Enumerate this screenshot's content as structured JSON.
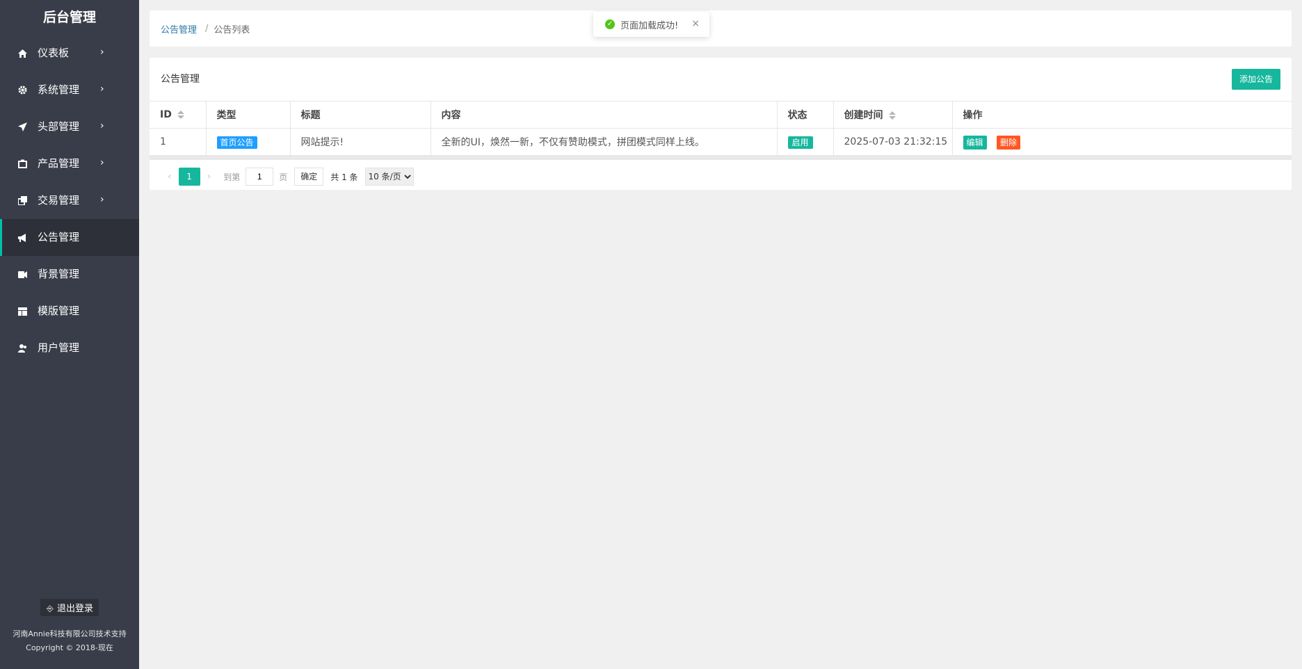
{
  "sidebar": {
    "brand": "后台管理",
    "items": [
      {
        "label": "仪表板",
        "icon": "home-icon",
        "has_arrow": true
      },
      {
        "label": "系统管理",
        "icon": "gear-icon",
        "has_arrow": true
      },
      {
        "label": "头部管理",
        "icon": "send-icon",
        "has_arrow": true
      },
      {
        "label": "产品管理",
        "icon": "box-icon",
        "has_arrow": true
      },
      {
        "label": "交易管理",
        "icon": "copy-icon",
        "has_arrow": true
      },
      {
        "label": "公告管理",
        "icon": "megaphone-icon",
        "has_arrow": false,
        "active": true
      },
      {
        "label": "背景管理",
        "icon": "video-icon",
        "has_arrow": false
      },
      {
        "label": "模版管理",
        "icon": "layout-icon",
        "has_arrow": false
      },
      {
        "label": "用户管理",
        "icon": "users-icon",
        "has_arrow": false
      }
    ],
    "arrow_glyph": "›",
    "logout_label": "退出登录",
    "support_text": "河南Annie科技有限公司技术支持",
    "copyright_text": "Copyright © 2018-现在"
  },
  "breadcrumb": {
    "parent": "公告管理",
    "separator": "/",
    "current": "公告列表"
  },
  "toast": {
    "message": "页面加载成功!",
    "close_glyph": "×"
  },
  "card": {
    "title": "公告管理",
    "add_label": "添加公告"
  },
  "table": {
    "columns": [
      "ID",
      "类型",
      "标题",
      "内容",
      "状态",
      "创建时间",
      "操作"
    ],
    "rows": [
      {
        "id": "1",
        "type": "首页公告",
        "title": "网站提示!",
        "content": "全新的UI，焕然一新，不仅有赞助模式，拼团模式同样上线。",
        "status": "启用",
        "created": "2025-07-03 21:32:15",
        "edit_label": "编辑",
        "delete_label": "删除"
      }
    ]
  },
  "pagination": {
    "prev_glyph": "‹",
    "current_page": "1",
    "next_glyph": "›",
    "goto_label": "到第",
    "goto_value": "1",
    "page_suffix": "页",
    "confirm_label": "确定",
    "total_text": "共 1 条",
    "page_size": "10 条/页"
  },
  "colors": {
    "sidebar_bg": "#393d49",
    "accent": "#16b79d",
    "type_badge": "#1e9fff",
    "delete": "#ff5722",
    "success": "#52c41a"
  }
}
